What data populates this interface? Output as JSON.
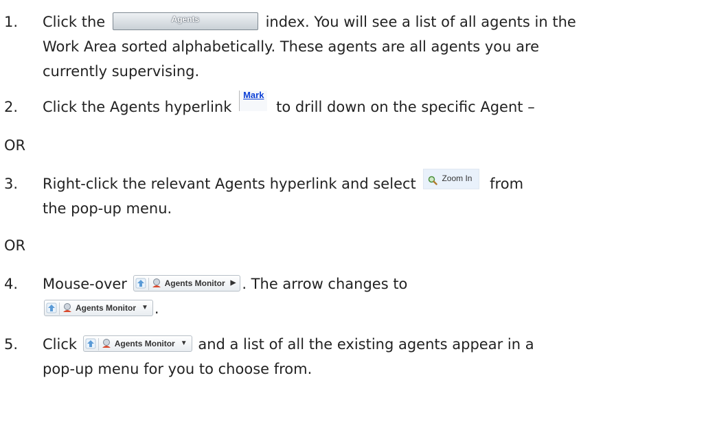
{
  "steps": [
    {
      "number": "1.",
      "before": "Click the",
      "button_label": "Agents",
      "after_inline": "index. You will see a list of all agents in the",
      "line2": "Work Area sorted alphabetically. These agents are all agents you are",
      "line3": "currently supervising."
    },
    {
      "number": "2.",
      "before": "Click the Agents hyperlink",
      "link_label": "Mark",
      "after": "to drill down on the specific Agent –"
    },
    {
      "number": "3.",
      "before": "Right-click the relevant Agents hyperlink and select",
      "menu_item_label": "Zoom In",
      "after": "from",
      "line2": "the pop-up menu."
    },
    {
      "number": "4.",
      "before": "Mouse-over",
      "crumb_label": "Agents Monitor",
      "after": ". The arrow changes to",
      "crumb2_label": "Agents Monitor",
      "after2": "."
    },
    {
      "number": "5.",
      "before": "Click",
      "crumb_label": "Agents Monitor",
      "after": "and a list of all the existing agents appear in a",
      "line2": "pop-up menu for you to choose from."
    }
  ],
  "or_label": "OR",
  "icons": {
    "up": "up-arrow-icon",
    "monitor": "agent-monitor-icon",
    "zoom": "magnifier-icon",
    "arrow_right": "triangle-right-icon",
    "arrow_down": "triangle-down-icon"
  },
  "colors": {
    "text": "#222222",
    "link": "#0b3fd6",
    "menu_bg": "#e9f1fb"
  }
}
